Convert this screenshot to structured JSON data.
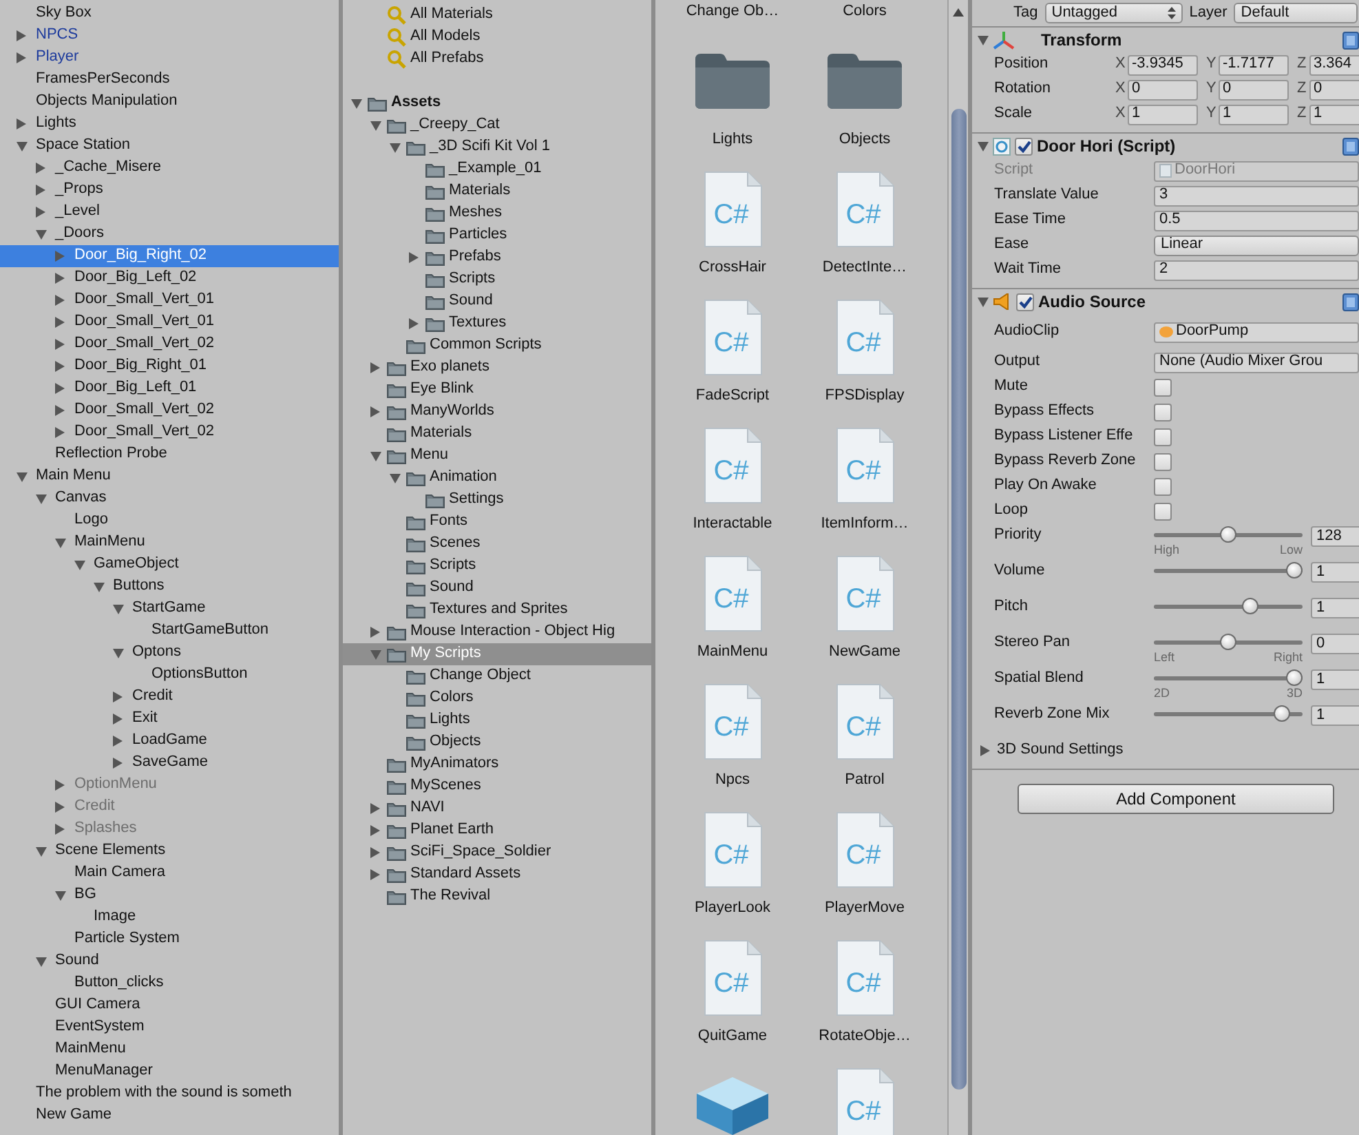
{
  "hierarchy": {
    "items": [
      {
        "label": "Sky Box",
        "kind": "object",
        "selected": false
      },
      {
        "label": "NPCS",
        "kind": "prefab",
        "selected": false,
        "expanded": false
      },
      {
        "label": "Player",
        "kind": "prefab",
        "selected": false,
        "expanded": false
      },
      {
        "label": "FramesPerSeconds",
        "kind": "object",
        "selected": false
      },
      {
        "label": "Objects Manipulation",
        "kind": "object",
        "selected": false
      },
      {
        "label": "Lights",
        "kind": "object",
        "selected": false,
        "expanded": false
      },
      {
        "label": "Space Station",
        "kind": "object",
        "selected": false,
        "expanded": true,
        "children": [
          {
            "label": "_Cache_Misere",
            "kind": "object",
            "selected": false,
            "expanded": false
          },
          {
            "label": "_Props",
            "kind": "object",
            "selected": false,
            "expanded": false
          },
          {
            "label": "_Level",
            "kind": "object",
            "selected": false,
            "expanded": false
          },
          {
            "label": "_Doors",
            "kind": "object",
            "selected": false,
            "expanded": true,
            "children": [
              {
                "label": "Door_Big_Right_02",
                "kind": "object",
                "selected": true,
                "expanded": false
              },
              {
                "label": "Door_Big_Left_02",
                "kind": "object",
                "selected": false,
                "expanded": false
              },
              {
                "label": "Door_Small_Vert_01",
                "kind": "object",
                "selected": false,
                "expanded": false
              },
              {
                "label": "Door_Small_Vert_01",
                "kind": "object",
                "selected": false,
                "expanded": false
              },
              {
                "label": "Door_Small_Vert_02",
                "kind": "object",
                "selected": false,
                "expanded": false
              },
              {
                "label": "Door_Big_Right_01",
                "kind": "object",
                "selected": false,
                "expanded": false
              },
              {
                "label": "Door_Big_Left_01",
                "kind": "object",
                "selected": false,
                "expanded": false
              },
              {
                "label": "Door_Small_Vert_02",
                "kind": "object",
                "selected": false,
                "expanded": false
              },
              {
                "label": "Door_Small_Vert_02",
                "kind": "object",
                "selected": false,
                "expanded": false
              }
            ]
          },
          {
            "label": "Reflection Probe",
            "kind": "object",
            "selected": false
          }
        ]
      },
      {
        "label": "Main Menu",
        "kind": "object",
        "selected": false,
        "expanded": true,
        "children": [
          {
            "label": "Canvas",
            "kind": "object",
            "selected": false,
            "expanded": true,
            "children": [
              {
                "label": "Logo",
                "kind": "object",
                "selected": false
              },
              {
                "label": "MainMenu",
                "kind": "object",
                "selected": false,
                "expanded": true,
                "children": [
                  {
                    "label": "GameObject",
                    "kind": "object",
                    "selected": false,
                    "expanded": true,
                    "children": [
                      {
                        "label": "Buttons",
                        "kind": "object",
                        "selected": false,
                        "expanded": true,
                        "children": [
                          {
                            "label": "StartGame",
                            "kind": "object",
                            "selected": false,
                            "expanded": true,
                            "children": [
                              {
                                "label": "StartGameButton",
                                "kind": "object",
                                "selected": false
                              }
                            ]
                          },
                          {
                            "label": "Optons",
                            "kind": "object",
                            "selected": false,
                            "expanded": true,
                            "children": [
                              {
                                "label": "OptionsButton",
                                "kind": "object",
                                "selected": false
                              }
                            ]
                          },
                          {
                            "label": "Credit",
                            "kind": "object",
                            "selected": false,
                            "expanded": false
                          },
                          {
                            "label": "Exit",
                            "kind": "object",
                            "selected": false,
                            "expanded": false
                          },
                          {
                            "label": "LoadGame",
                            "kind": "object",
                            "selected": false,
                            "expanded": false
                          },
                          {
                            "label": "SaveGame",
                            "kind": "object",
                            "selected": false,
                            "expanded": false
                          }
                        ]
                      }
                    ]
                  }
                ]
              },
              {
                "label": "OptionMenu",
                "kind": "inactive",
                "selected": false,
                "expanded": false
              },
              {
                "label": "Credit",
                "kind": "inactive",
                "selected": false,
                "expanded": false
              },
              {
                "label": "Splashes",
                "kind": "inactive",
                "selected": false,
                "expanded": false
              }
            ]
          },
          {
            "label": "Scene Elements",
            "kind": "object",
            "selected": false,
            "expanded": true,
            "children": [
              {
                "label": "Main Camera",
                "kind": "object",
                "selected": false
              },
              {
                "label": "BG",
                "kind": "object",
                "selected": false,
                "expanded": true,
                "children": [
                  {
                    "label": "Image",
                    "kind": "object",
                    "selected": false
                  }
                ]
              },
              {
                "label": "Particle System",
                "kind": "object",
                "selected": false
              }
            ]
          },
          {
            "label": "Sound",
            "kind": "object",
            "selected": false,
            "expanded": true,
            "children": [
              {
                "label": "Button_clicks",
                "kind": "object",
                "selected": false
              }
            ]
          },
          {
            "label": "GUI Camera",
            "kind": "object",
            "selected": false
          },
          {
            "label": "EventSystem",
            "kind": "object",
            "selected": false
          },
          {
            "label": "MainMenu",
            "kind": "object",
            "selected": false
          },
          {
            "label": "MenuManager",
            "kind": "object",
            "selected": false
          }
        ]
      },
      {
        "label": "The problem with the sound is someth",
        "kind": "object",
        "selected": false
      },
      {
        "label": "New Game",
        "kind": "object",
        "selected": false
      }
    ]
  },
  "project": {
    "favorites": [
      {
        "label": "All Materials",
        "selected": false
      },
      {
        "label": "All Models",
        "selected": false
      },
      {
        "label": "All Prefabs",
        "selected": false
      }
    ],
    "tree": [
      {
        "label": "Assets",
        "selected": false,
        "expanded": true,
        "children": [
          {
            "label": "_Creepy_Cat",
            "selected": false,
            "expanded": true,
            "children": [
              {
                "label": "_3D Scifi Kit Vol 1",
                "selected": false,
                "expanded": true,
                "children": [
                  {
                    "label": "_Example_01",
                    "selected": false
                  },
                  {
                    "label": "Materials",
                    "selected": false
                  },
                  {
                    "label": "Meshes",
                    "selected": false
                  },
                  {
                    "label": "Particles",
                    "selected": false
                  },
                  {
                    "label": "Prefabs",
                    "selected": false,
                    "expanded": false
                  },
                  {
                    "label": "Scripts",
                    "selected": false
                  },
                  {
                    "label": "Sound",
                    "selected": false
                  },
                  {
                    "label": "Textures",
                    "selected": false,
                    "expanded": false
                  }
                ]
              },
              {
                "label": "Common Scripts",
                "selected": false
              }
            ]
          },
          {
            "label": "Exo planets",
            "selected": false,
            "expanded": false
          },
          {
            "label": "Eye Blink",
            "selected": false
          },
          {
            "label": "ManyWorlds",
            "selected": false,
            "expanded": false
          },
          {
            "label": "Materials",
            "selected": false
          },
          {
            "label": "Menu",
            "selected": false,
            "expanded": true,
            "children": [
              {
                "label": "Animation",
                "selected": false,
                "expanded": true,
                "children": [
                  {
                    "label": "Settings",
                    "selected": false
                  }
                ]
              },
              {
                "label": "Fonts",
                "selected": false
              },
              {
                "label": "Scenes",
                "selected": false
              },
              {
                "label": "Scripts",
                "selected": false
              },
              {
                "label": "Sound",
                "selected": false
              },
              {
                "label": "Textures and Sprites",
                "selected": false
              }
            ]
          },
          {
            "label": "Mouse Interaction - Object Hig",
            "selected": false,
            "expanded": false
          },
          {
            "label": "My Scripts",
            "selected": true,
            "expanded": true,
            "children": [
              {
                "label": "Change Object",
                "selected": false
              },
              {
                "label": "Colors",
                "selected": false
              },
              {
                "label": "Lights",
                "selected": false
              },
              {
                "label": "Objects",
                "selected": false
              }
            ]
          },
          {
            "label": "MyAnimators",
            "selected": false
          },
          {
            "label": "MyScenes",
            "selected": false
          },
          {
            "label": "NAVI",
            "selected": false,
            "expanded": false
          },
          {
            "label": "Planet Earth",
            "selected": false,
            "expanded": false
          },
          {
            "label": "SciFi_Space_Soldier",
            "selected": false,
            "expanded": false
          },
          {
            "label": "Standard Assets",
            "selected": false,
            "expanded": false
          },
          {
            "label": "The Revival",
            "selected": false
          }
        ]
      }
    ]
  },
  "assets": {
    "items": [
      {
        "label": "Change Ob…",
        "kind": "folder"
      },
      {
        "label": "Colors",
        "kind": "folder"
      },
      {
        "label": "Lights",
        "kind": "folder"
      },
      {
        "label": "Objects",
        "kind": "folder"
      },
      {
        "label": "CrossHair",
        "kind": "script",
        "icon_text": "C#"
      },
      {
        "label": "DetectInte…",
        "kind": "script",
        "icon_text": "C#"
      },
      {
        "label": "FadeScript",
        "kind": "script",
        "icon_text": "C#"
      },
      {
        "label": "FPSDisplay",
        "kind": "script",
        "icon_text": "C#"
      },
      {
        "label": "Interactable",
        "kind": "script",
        "icon_text": "C#"
      },
      {
        "label": "ItemInform…",
        "kind": "script",
        "icon_text": "C#"
      },
      {
        "label": "MainMenu",
        "kind": "script",
        "icon_text": "C#"
      },
      {
        "label": "NewGame",
        "kind": "script",
        "icon_text": "C#"
      },
      {
        "label": "Npcs",
        "kind": "script",
        "icon_text": "C#"
      },
      {
        "label": "Patrol",
        "kind": "script",
        "icon_text": "C#"
      },
      {
        "label": "PlayerLook",
        "kind": "script",
        "icon_text": "C#"
      },
      {
        "label": "PlayerMove",
        "kind": "script",
        "icon_text": "C#"
      },
      {
        "label": "QuitGame",
        "kind": "script",
        "icon_text": "C#"
      },
      {
        "label": "RotateObje…",
        "kind": "script",
        "icon_text": "C#"
      },
      {
        "kind": "scene"
      },
      {
        "kind": "script",
        "icon_text": "C#"
      }
    ]
  },
  "inspector": {
    "tag_label": "Tag",
    "tag": "Untagged",
    "layer_label": "Layer",
    "layer": "Default",
    "components": [
      {
        "kind": "transform",
        "title": "Transform",
        "expanded": true,
        "rows": [
          {
            "kind": "vector",
            "label": "Position",
            "fields": [
              {
                "axis": "X",
                "value": "-3.9345"
              },
              {
                "axis": "Y",
                "value": "-1.7177"
              },
              {
                "axis": "Z",
                "value": "3.364"
              }
            ]
          },
          {
            "kind": "vector",
            "label": "Rotation",
            "fields": [
              {
                "axis": "X",
                "value": "0"
              },
              {
                "axis": "Y",
                "value": "0"
              },
              {
                "axis": "Z",
                "value": "0"
              }
            ]
          },
          {
            "kind": "vector",
            "label": "Scale",
            "fields": [
              {
                "axis": "X",
                "value": "1"
              },
              {
                "axis": "Y",
                "value": "1"
              },
              {
                "axis": "Z",
                "value": "1"
              }
            ]
          }
        ]
      },
      {
        "kind": "script",
        "title": "Door Hori (Script)",
        "expanded": true,
        "enabled": true,
        "rows": [
          {
            "kind": "readonly",
            "label": "Script",
            "value": "DoorHori"
          },
          {
            "kind": "text",
            "label": "Translate Value",
            "value": "3"
          },
          {
            "kind": "text",
            "label": "Ease Time",
            "value": "0.5"
          },
          {
            "kind": "dropdown",
            "label": "Ease",
            "value": "Linear"
          },
          {
            "kind": "text",
            "label": "Wait Time",
            "value": "2"
          }
        ]
      },
      {
        "kind": "audio",
        "title": "Audio Source",
        "expanded": true,
        "enabled": true,
        "rows": [
          {
            "kind": "clip",
            "label": "AudioClip",
            "value": "DoorPump"
          },
          {
            "kind": "text",
            "label": "Output",
            "value": "None (Audio Mixer Grou"
          },
          {
            "kind": "checkbox",
            "label": "Mute",
            "checked": false
          },
          {
            "kind": "checkbox",
            "label": "Bypass Effects",
            "checked": false
          },
          {
            "kind": "checkbox",
            "label": "Bypass Listener Effe",
            "checked": false
          },
          {
            "kind": "checkbox",
            "label": "Bypass Reverb Zone",
            "checked": false
          },
          {
            "kind": "checkbox",
            "label": "Play On Awake",
            "checked": false
          },
          {
            "kind": "checkbox",
            "label": "Loop",
            "checked": false
          },
          {
            "kind": "slider",
            "label": "Priority",
            "level": 0.5,
            "value": "128",
            "min_label": "High",
            "max_label": "Low"
          },
          {
            "kind": "slider",
            "label": "Volume",
            "level": 1,
            "value": "1"
          },
          {
            "kind": "slider",
            "label": "Pitch",
            "level": 0.67,
            "value": "1"
          },
          {
            "kind": "slider",
            "label": "Stereo Pan",
            "level": 0.5,
            "value": "0",
            "min_label": "Left",
            "max_label": "Right"
          },
          {
            "kind": "slider",
            "label": "Spatial Blend",
            "level": 1,
            "value": "1",
            "min_label": "2D",
            "max_label": "3D"
          },
          {
            "kind": "slider",
            "label": "Reverb Zone Mix",
            "level": 0.91,
            "value": "1"
          }
        ],
        "foldout": {
          "label": "3D Sound Settings",
          "expanded": false
        }
      }
    ],
    "add_component": "Add Component"
  }
}
